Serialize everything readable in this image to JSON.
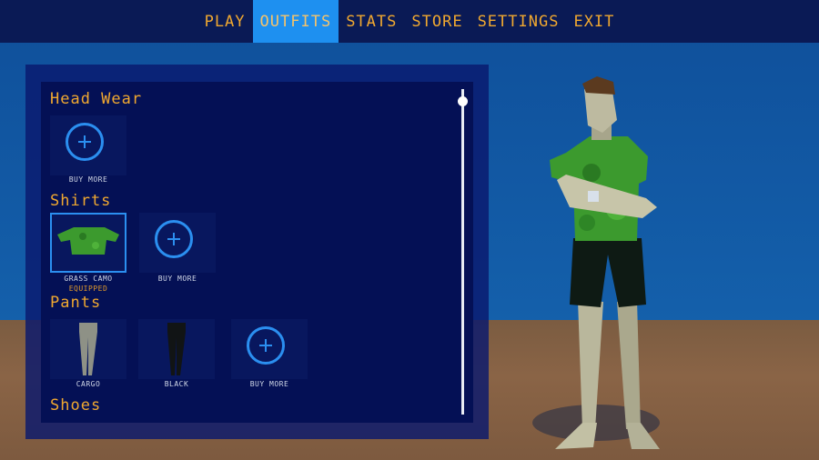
{
  "nav": {
    "items": [
      {
        "label": "PLAY",
        "active": false
      },
      {
        "label": "OUTFITS",
        "active": true
      },
      {
        "label": "STATS",
        "active": false
      },
      {
        "label": "STORE",
        "active": false
      },
      {
        "label": "SETTINGS",
        "active": false
      },
      {
        "label": "EXIT",
        "active": false
      }
    ]
  },
  "sections": {
    "head_wear": {
      "title": "Head Wear",
      "buy_more": "BUY MORE"
    },
    "shirts": {
      "title": "Shirts",
      "items": [
        {
          "name": "GRASS CAMO",
          "status": "EQUIPPED"
        }
      ],
      "buy_more": "BUY MORE"
    },
    "pants": {
      "title": "Pants",
      "items": [
        {
          "name": "CARGO"
        },
        {
          "name": "BLACK"
        }
      ],
      "buy_more": "BUY MORE"
    },
    "shoes": {
      "title": "Shoes"
    }
  },
  "colors": {
    "accent": "#2b8ff0",
    "nav_text": "#f0a830",
    "equipped": "#e29a2a"
  },
  "icons": {
    "buy_more": "plus-circle-icon"
  },
  "scroll": {
    "position": 0.0
  }
}
